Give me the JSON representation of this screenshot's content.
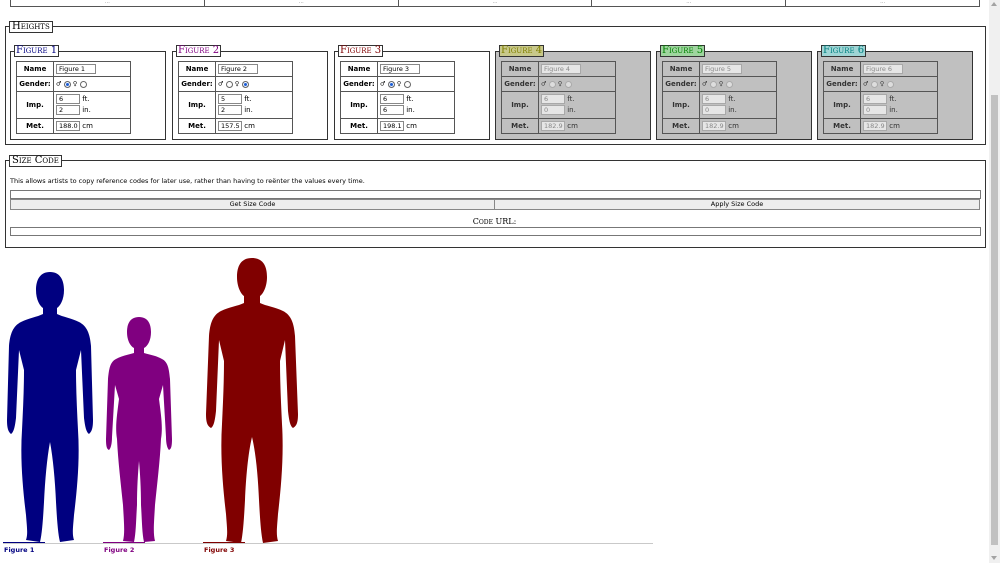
{
  "top_row": {
    "cells": [
      "…",
      "…",
      "…",
      "…",
      "…"
    ]
  },
  "heights": {
    "legend": "Heights",
    "figures": [
      {
        "legend": "Figure 1",
        "color": "#000080",
        "name": "Figure 1",
        "gender": "male",
        "feet": "6",
        "inches": "2",
        "cm": "188.0",
        "active": true
      },
      {
        "legend": "Figure 2",
        "color": "#800080",
        "name": "Figure 2",
        "gender": "female",
        "feet": "5",
        "inches": "2",
        "cm": "157.5",
        "active": true
      },
      {
        "legend": "Figure 3",
        "color": "#800000",
        "name": "Figure 3",
        "gender": "male",
        "feet": "6",
        "inches": "6",
        "cm": "198.1",
        "active": true
      },
      {
        "legend": "Figure 4",
        "color": "#808000",
        "name": "Figure 4",
        "gender": "none",
        "feet": "6",
        "inches": "0",
        "cm": "182.9",
        "active": false
      },
      {
        "legend": "Figure 5",
        "color": "#008000",
        "name": "Figure 5",
        "gender": "none",
        "feet": "6",
        "inches": "0",
        "cm": "182.9",
        "active": false
      },
      {
        "legend": "Figure 6",
        "color": "#008080",
        "name": "Figure 6",
        "gender": "none",
        "feet": "6",
        "inches": "0",
        "cm": "182.9",
        "active": false
      }
    ],
    "labels": {
      "name": "Name",
      "gender": "Gender:",
      "imp": "Imp.",
      "met": "Met.",
      "ft": "ft.",
      "in": "in.",
      "cm": "cm"
    }
  },
  "size_code": {
    "legend": "Size Code",
    "description": "This allows artists to copy reference codes for later use, rather than having to reënter the values every time.",
    "get_button": "Get Size Code",
    "apply_button": "Apply Size Code",
    "url_label": "Code URL:"
  },
  "chart": {
    "labels": [
      "Figure 1",
      "Figure 2",
      "Figure 3"
    ],
    "colors": [
      "#000080",
      "#800080",
      "#800000"
    ]
  }
}
